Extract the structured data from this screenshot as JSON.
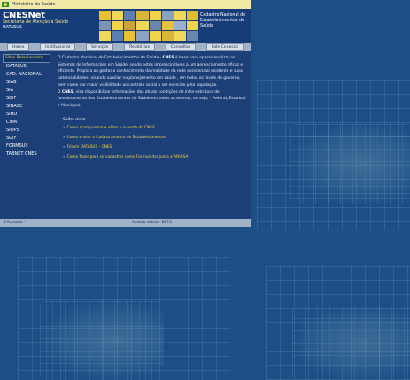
{
  "gov_bar": {
    "label": "Ministério da Saúde"
  },
  "header": {
    "title": "CNESNet",
    "subtitle_line1": "Secretaria de Atenção à Saúde",
    "subtitle_line2": "DATASUS",
    "right_line1": "Cadastro Nacional de",
    "right_line2": "Estabelecimentos de",
    "right_line3": "Saúde"
  },
  "nav": [
    {
      "label": "Home"
    },
    {
      "label": "Institucional"
    },
    {
      "label": "Serviços"
    },
    {
      "label": "Relatórios"
    },
    {
      "label": "Consultas"
    },
    {
      "label": "Fale Conosco"
    }
  ],
  "sidebar": {
    "heading": "Sites Relacionados",
    "items": [
      {
        "label": "DATASUS"
      },
      {
        "label": "CAD. NACIONAL"
      },
      {
        "label": "SIAB"
      },
      {
        "label": "SIA"
      },
      {
        "label": "SGIF"
      },
      {
        "label": "SINASC"
      },
      {
        "label": "SIHD"
      },
      {
        "label": "CIHA"
      },
      {
        "label": "SIOPS"
      },
      {
        "label": "SGIF"
      },
      {
        "label": "FORMSUS"
      },
      {
        "label": "TABNET CNES"
      }
    ]
  },
  "main": {
    "p1_name": "CNES",
    "p1_before": "O Cadastro Nacional de Estabelecimentos de Saúde - ",
    "p1_after": " é base para operacionalizar os Sistemas de Informações em Saúde, sendo estes imprescindíveis a um gerenciamento eficaz e eficiente. Propicia ao gestor o conhecimento da realidade da rede assistencial existente e suas potencialidades, visando auxiliar no planejamento em saúde , em todos os níveis de governo, bem como dar maior visibilidade ao controle social a ser exercido pela população.",
    "p2_before": "O ",
    "p2_name": "CNES",
    "p2_after": ", visa disponibilizar informações das atuais condições de infra-estrutura de funcionamento dos Estabelecimentos de Saúde em todas as esferas, ou seja, - Federal, Estadual e Municipal."
  },
  "links": {
    "heading": "Saiba mais:",
    "items": [
      {
        "label": "Como acompanhar e obter o suporte do CNES"
      },
      {
        "label": "Como enviar o Cadastramento de Estabelecimentos"
      },
      {
        "label": "Fórum DATASUS - CNES"
      },
      {
        "label": "Como fazer para se cadastrar como Formulador junto a ANVISA"
      }
    ]
  },
  "footer": {
    "left": "T.Acessos -",
    "center": "Acesso diario - 6675"
  },
  "colors": {
    "page_bg": "#1b4f86",
    "nav_bg": "#9fb2c7",
    "accent_yellow": "#f3d34a"
  }
}
